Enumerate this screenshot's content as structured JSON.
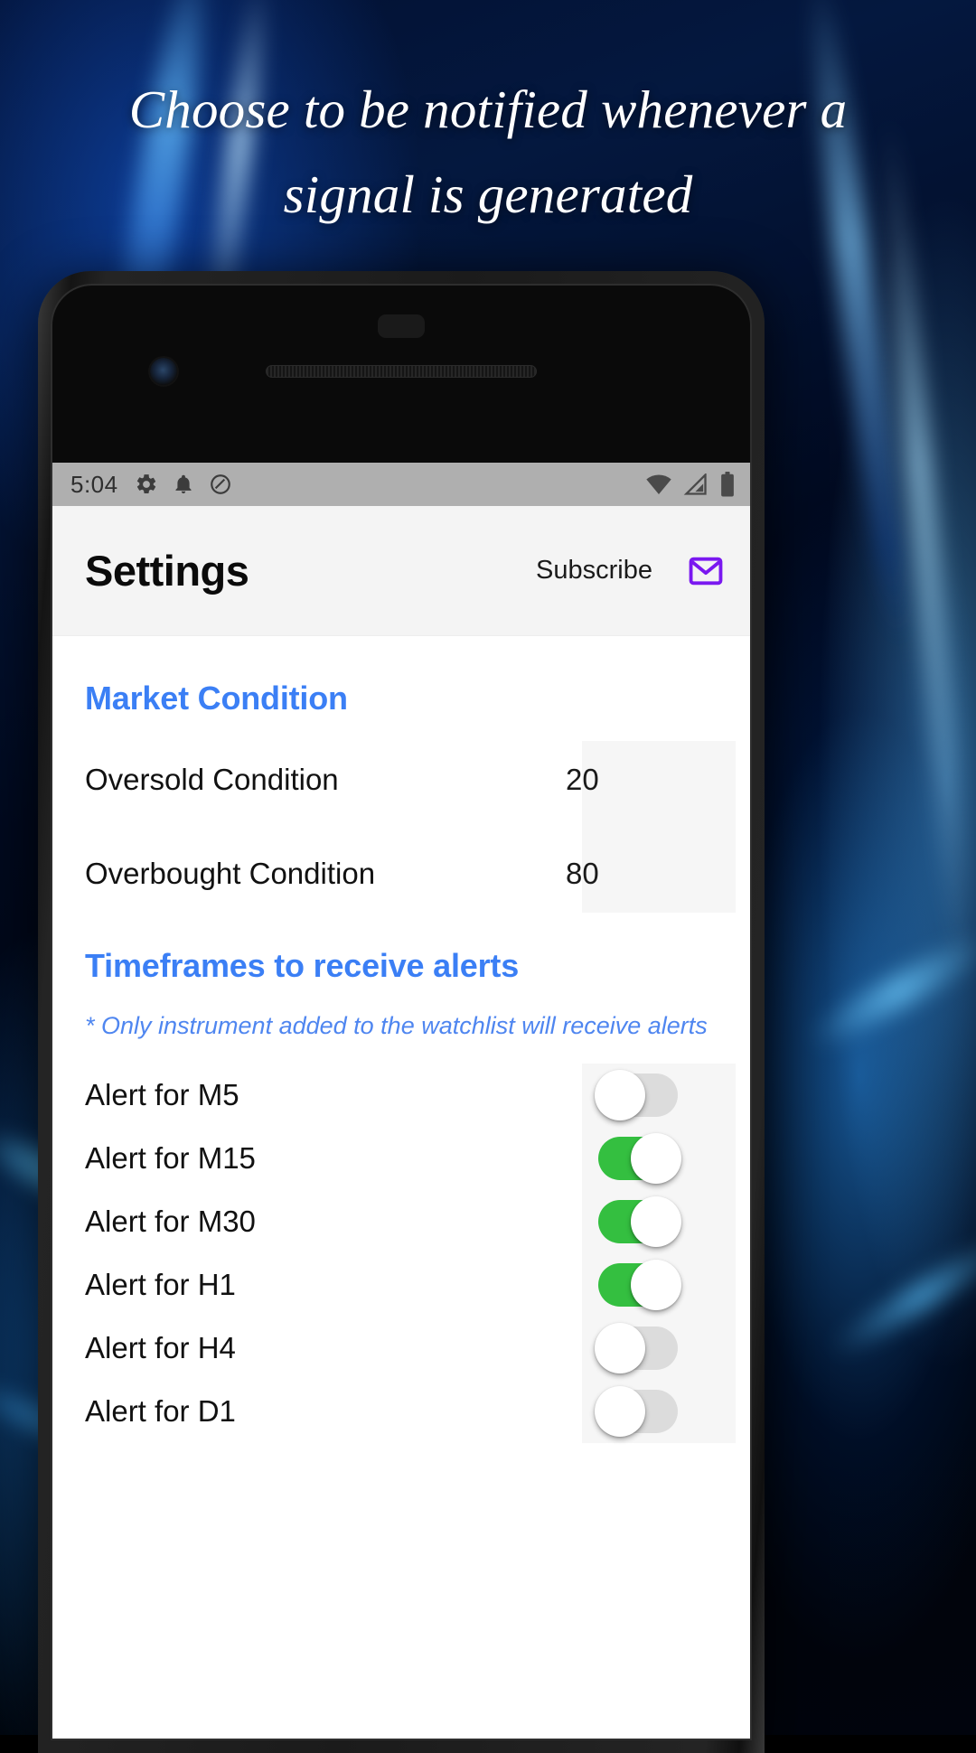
{
  "headline": "Choose to be notified whenever a signal is generated",
  "colors": {
    "accent_blue": "#3b7ff5",
    "note_blue": "#4f86f0",
    "switch_on_green": "#34bf40",
    "switch_off_gray": "#dcdcdc",
    "mail_purple": "#7a18f0",
    "statusbar_gray": "#afafaf",
    "appbar_gray": "#f4f4f4"
  },
  "statusbar": {
    "time": "5:04",
    "left_icons": [
      "gear-icon",
      "bell-icon",
      "do-not-disturb-icon"
    ],
    "right_icons": [
      "wifi-icon",
      "cellular-signal-icon",
      "battery-icon"
    ]
  },
  "appbar": {
    "title": "Settings",
    "subscribe_label": "Subscribe",
    "mail_icon": "mail-icon"
  },
  "sections": [
    {
      "title": "Market Condition",
      "rows": [
        {
          "label": "Oversold Condition",
          "value": "20"
        },
        {
          "label": "Overbought Condition",
          "value": "80"
        }
      ]
    },
    {
      "title": "Timeframes to receive alerts",
      "note": "* Only instrument added to the watchlist will receive alerts",
      "alerts": [
        {
          "label": "Alert for M5",
          "state": "off"
        },
        {
          "label": "Alert for M15",
          "state": "on"
        },
        {
          "label": "Alert for M30",
          "state": "on"
        },
        {
          "label": "Alert for H1",
          "state": "on"
        },
        {
          "label": "Alert for H4",
          "state": "off"
        },
        {
          "label": "Alert for D1",
          "state": "off"
        }
      ]
    }
  ]
}
